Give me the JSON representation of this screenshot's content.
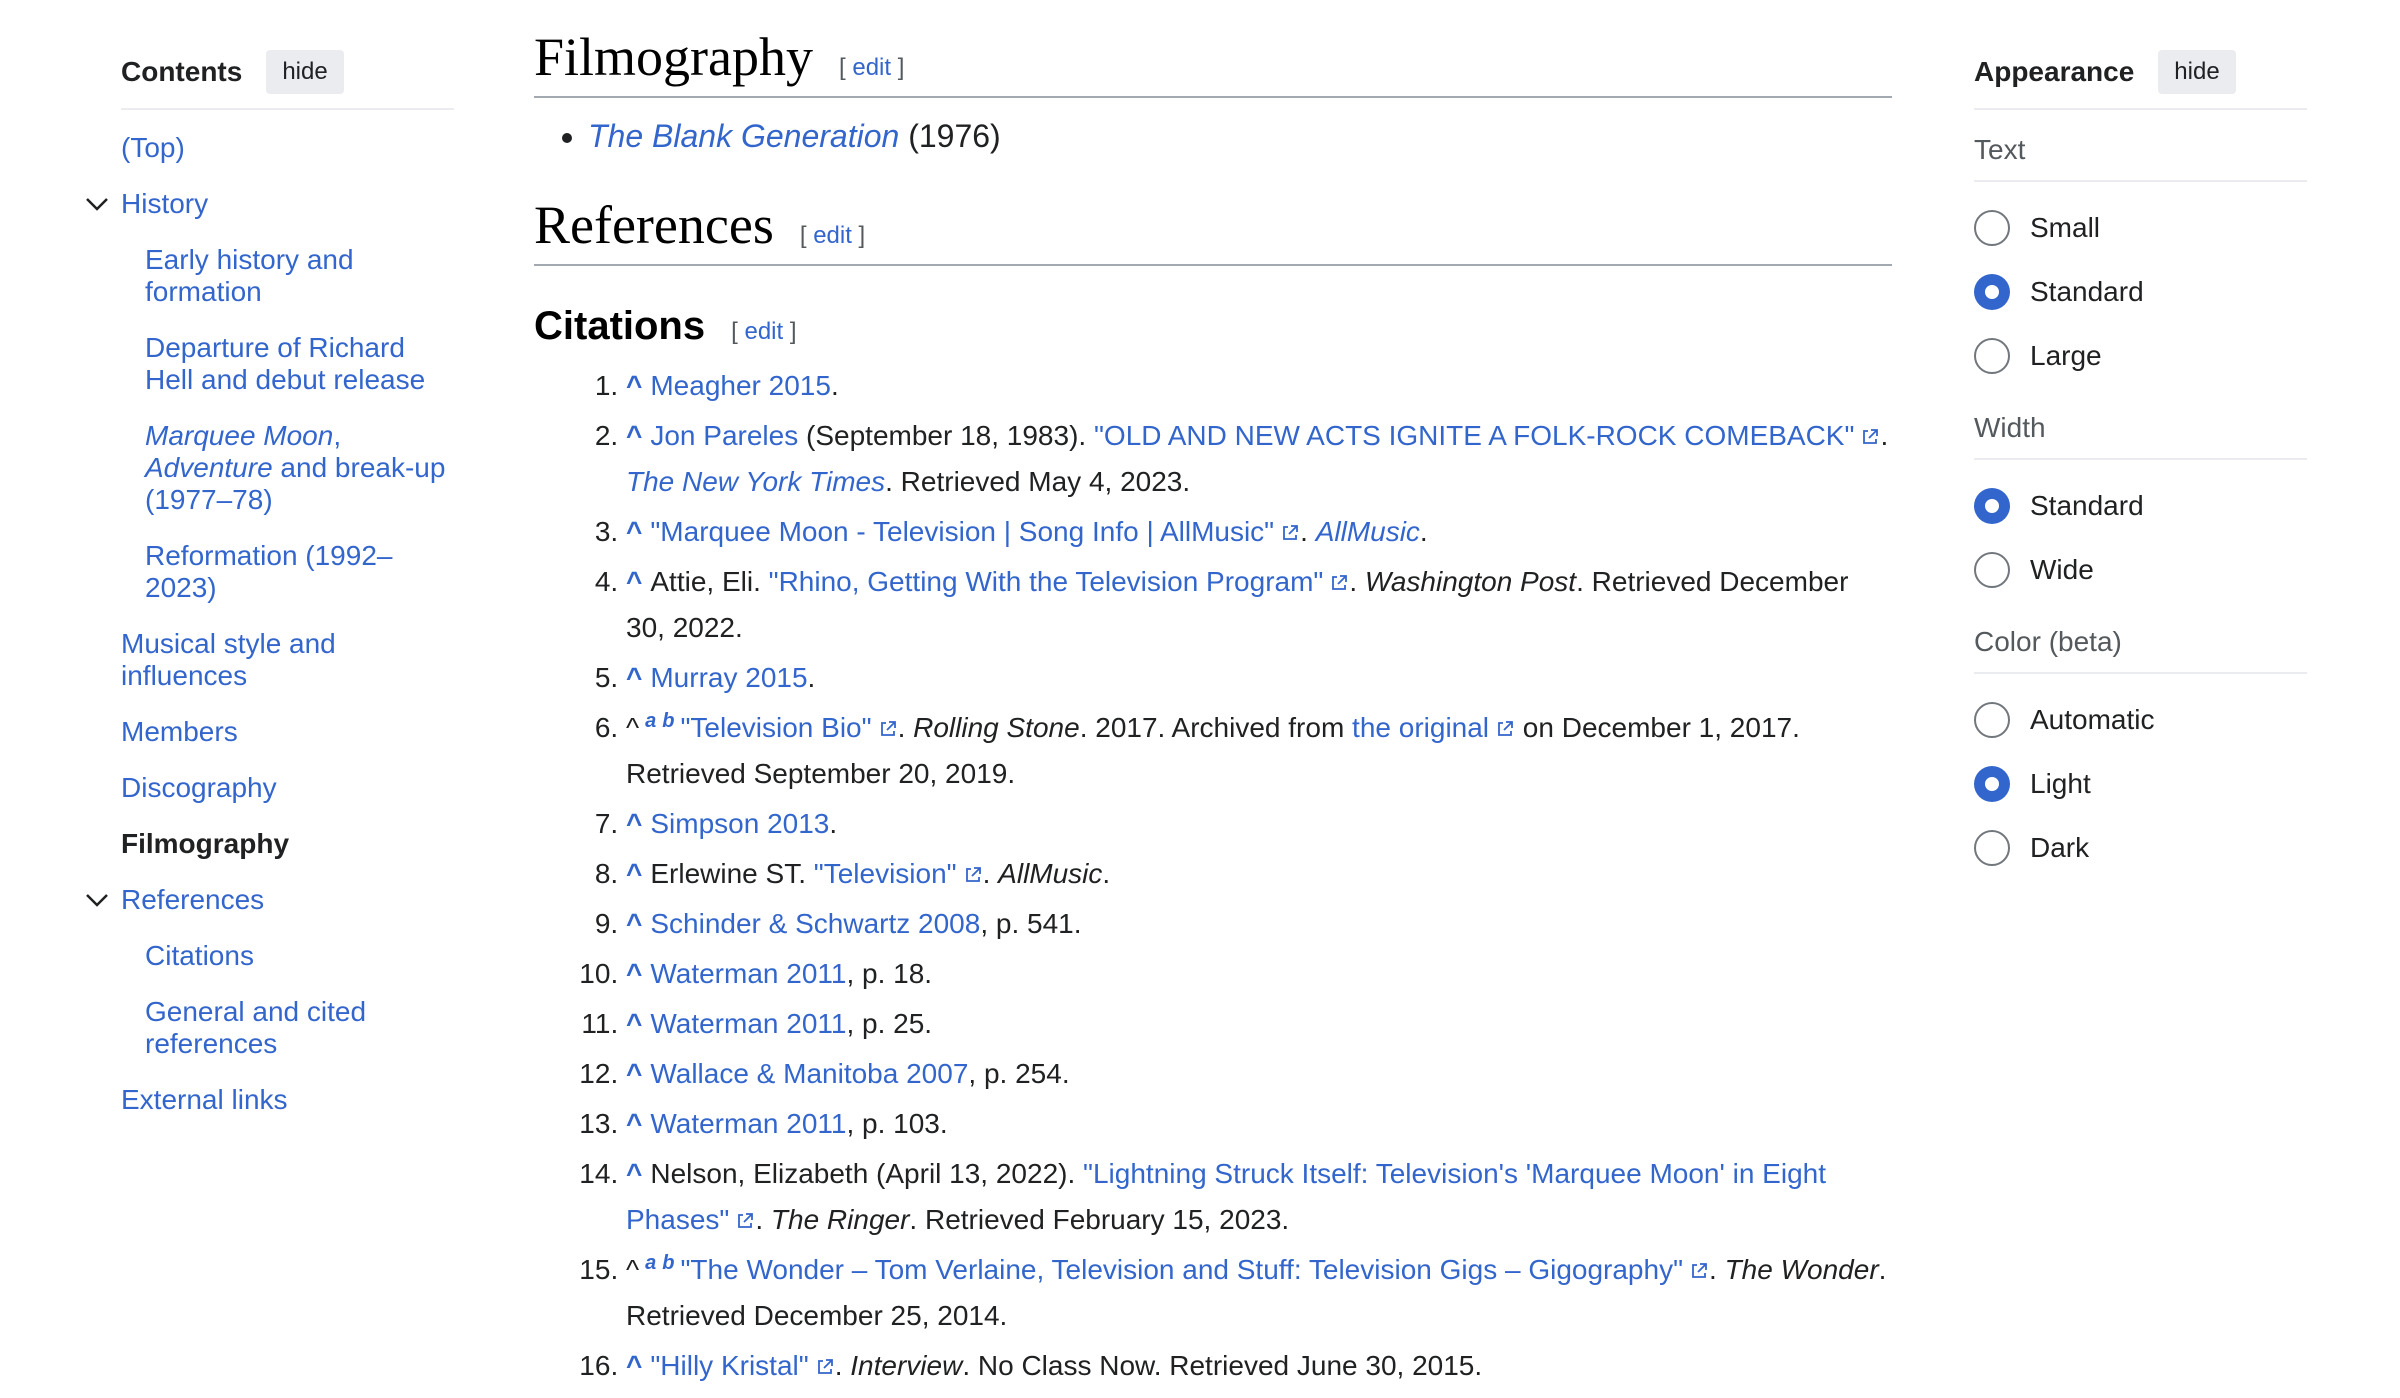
{
  "toc": {
    "title": "Contents",
    "hide_label": "hide",
    "items": [
      {
        "label": "(Top)"
      },
      {
        "label": "History"
      },
      {
        "label": "Early history and formation"
      },
      {
        "label": "Departure of Richard Hell and debut release"
      },
      {
        "label_italic_1": "Marquee Moon",
        "label_mid": ", ",
        "label_italic_2": "Adventure",
        "label_rest": " and break-up (1977–78)"
      },
      {
        "label": "Reformation (1992–2023)"
      },
      {
        "label": "Musical style and influences"
      },
      {
        "label": "Members"
      },
      {
        "label": "Discography"
      },
      {
        "label": "Filmography"
      },
      {
        "label": "References"
      },
      {
        "label": "Citations"
      },
      {
        "label": "General and cited references"
      },
      {
        "label": "External links"
      }
    ]
  },
  "main": {
    "filmography": {
      "heading": "Filmography",
      "edit": "edit",
      "film_title": "The Blank Generation",
      "film_year": " (1976)"
    },
    "references": {
      "heading": "References",
      "edit": "edit"
    },
    "citations": {
      "heading": "Citations",
      "edit": "edit"
    },
    "cites": [
      {
        "link": "Meagher 2015",
        "tail": "."
      },
      {
        "a": "Jon Pareles",
        "b": " (September 18, 1983). ",
        "c": "\"OLD AND NEW ACTS IGNITE A FOLK-ROCK COMEBACK\"",
        "d": ". ",
        "e": "The New York Times",
        "f": ". Retrieved May 4, 2023."
      },
      {
        "a": "\"Marquee Moon - Television | Song Info | AllMusic\"",
        "b": ". ",
        "c": "AllMusic",
        "d": "."
      },
      {
        "a": "Attie, Eli. ",
        "b": "\"Rhino, Getting With the Television Program\"",
        "c": ". ",
        "d": "Washington Post",
        "e": ". Retrieved December 30, 2022."
      },
      {
        "link": "Murray 2015",
        "tail": "."
      },
      {
        "sup_a": "a",
        "sup_b": "b",
        "a": "\"Television Bio\"",
        "b": ". ",
        "c": "Rolling Stone",
        "d": ". 2017. Archived from ",
        "e": "the original",
        "f": " on December 1, 2017. Retrieved September 20, 2019."
      },
      {
        "link": "Simpson 2013",
        "tail": "."
      },
      {
        "a": "Erlewine ST. ",
        "b": "\"Television\"",
        "c": ". ",
        "d": "AllMusic",
        "e": "."
      },
      {
        "link": "Schinder & Schwartz 2008",
        "tail": ", p. 541."
      },
      {
        "link": "Waterman 2011",
        "tail": ", p. 18."
      },
      {
        "link": "Waterman 2011",
        "tail": ", p. 25."
      },
      {
        "link": "Wallace & Manitoba 2007",
        "tail": ", p. 254."
      },
      {
        "link": "Waterman 2011",
        "tail": ", p. 103."
      },
      {
        "a": "Nelson, Elizabeth (April 13, 2022). ",
        "b": "\"Lightning Struck Itself: Television's 'Marquee Moon' in Eight Phases\"",
        "c": ". ",
        "d": "The Ringer",
        "e": ". Retrieved February 15, 2023."
      },
      {
        "sup_a": "a",
        "sup_b": "b",
        "a": "\"The Wonder – Tom Verlaine, Television and Stuff: Television Gigs – Gigography\"",
        "b": ". ",
        "c": "The Wonder",
        "d": ". Retrieved December 25, 2014."
      },
      {
        "a": "\"Hilly Kristal\"",
        "b": ". ",
        "c": "Interview",
        "d": ". No Class Now. Retrieved June 30, 2015."
      }
    ]
  },
  "appearance": {
    "title": "Appearance",
    "hide_label": "hide",
    "text": {
      "label": "Text",
      "options": [
        "Small",
        "Standard",
        "Large"
      ],
      "selected": "Standard"
    },
    "width": {
      "label": "Width",
      "options": [
        "Standard",
        "Wide"
      ],
      "selected": "Standard"
    },
    "color": {
      "label": "Color (beta)",
      "options": [
        "Automatic",
        "Light",
        "Dark"
      ],
      "selected": "Light"
    }
  },
  "colors": {
    "link": "#3366cc",
    "text": "#202122",
    "muted": "#54595d",
    "rule": "#a2a9b1"
  }
}
